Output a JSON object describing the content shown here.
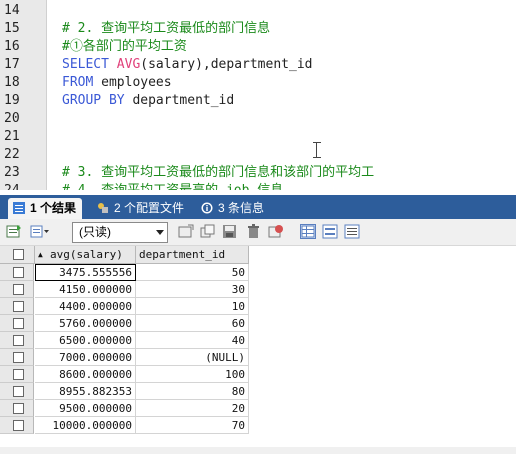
{
  "editor": {
    "lines": [
      {
        "num": "14",
        "segments": []
      },
      {
        "num": "15",
        "segments": [
          {
            "t": "# 2. 查询平均工资最低的部门信息",
            "c": "cmt"
          }
        ]
      },
      {
        "num": "16",
        "segments": [
          {
            "t": "#①各部门的平均工资",
            "c": "cmt"
          }
        ]
      },
      {
        "num": "17",
        "segments": [
          {
            "t": "SELECT ",
            "c": "kw"
          },
          {
            "t": "AVG",
            "c": "fn"
          },
          {
            "t": "(salary),department_id",
            "c": ""
          }
        ]
      },
      {
        "num": "18",
        "segments": [
          {
            "t": "FROM ",
            "c": "kw"
          },
          {
            "t": "employees",
            "c": ""
          }
        ]
      },
      {
        "num": "19",
        "segments": [
          {
            "t": "GROUP BY ",
            "c": "kw"
          },
          {
            "t": "department_id",
            "c": ""
          }
        ]
      },
      {
        "num": "20",
        "segments": []
      },
      {
        "num": "21",
        "segments": []
      },
      {
        "num": "22",
        "segments": []
      },
      {
        "num": "23",
        "segments": [
          {
            "t": "# 3. 查询平均工资最低的部门信息和该部门的平均工",
            "c": "cmt"
          }
        ]
      },
      {
        "num": "24",
        "segments": [
          {
            "t": "# 4. 查询平均工资最高的 job 信息",
            "c": "cmt"
          }
        ]
      }
    ]
  },
  "tabs": [
    {
      "num": "1",
      "label": "个结果",
      "active": true
    },
    {
      "num": "2",
      "label": "个配置文件",
      "active": false
    },
    {
      "num": "3",
      "label": "条信息",
      "active": false
    }
  ],
  "toolbar": {
    "mode_select": "(只读)"
  },
  "grid": {
    "columns": [
      "avg(salary)",
      "department_id"
    ],
    "sort_indicator": "▲",
    "rows": [
      [
        "3475.555556",
        "50"
      ],
      [
        "4150.000000",
        "30"
      ],
      [
        "4400.000000",
        "10"
      ],
      [
        "5760.000000",
        "60"
      ],
      [
        "6500.000000",
        "40"
      ],
      [
        "7000.000000",
        "(NULL)"
      ],
      [
        "8600.000000",
        "100"
      ],
      [
        "8955.882353",
        "80"
      ],
      [
        "9500.000000",
        "20"
      ],
      [
        "10000.000000",
        "70"
      ]
    ]
  },
  "colors": {
    "tab_bar": "#2d5d9b",
    "comment": "#1b8a1b",
    "keyword": "#3b59d6",
    "function": "#e0407a"
  }
}
